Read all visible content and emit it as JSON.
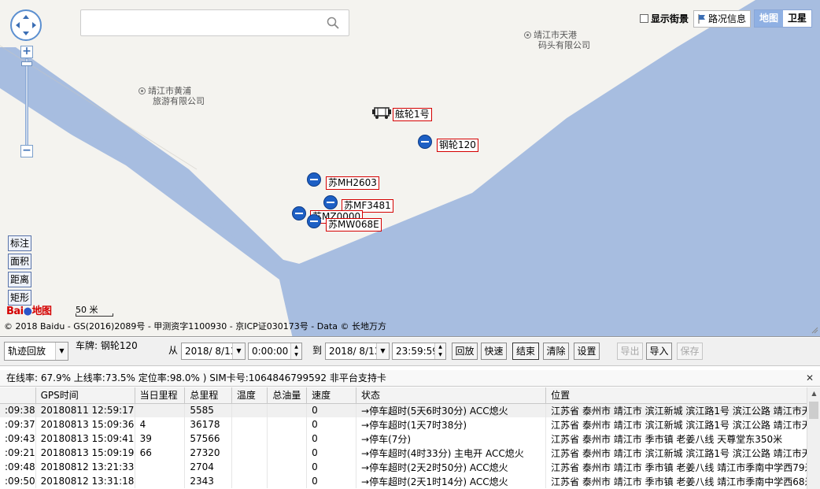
{
  "map": {
    "search_placeholder": "",
    "street_view_label": "显示街景",
    "traffic_label": "路况信息",
    "map_type_map": "地图",
    "map_type_satellite": "卫星",
    "zoom_in": "+",
    "zoom_out": "−",
    "tools": [
      "标注",
      "面积",
      "距离",
      "矩形"
    ],
    "scale_label": "50 米",
    "copyright": "© 2018 Baidu - GS(2016)2089号 - 甲测资字1100930 - 京ICP证030173号 - Data © 长地万方",
    "logo_text": "Bai地图",
    "pois": [
      {
        "line1": "靖江市黄浦",
        "line2": "旅游有限公司"
      },
      {
        "line1": "靖江市天港",
        "line2": "码头有限公司"
      }
    ],
    "vehicles": [
      "舷轮1号",
      "钢轮120",
      "苏MH2603",
      "苏MF3481",
      "苏MZ0000",
      "苏MW068E"
    ]
  },
  "toolbar": {
    "mode_select": "轨迹回放",
    "plate_label": "车牌: 钢轮120",
    "from_label": "从",
    "to_label": "到",
    "from_date": "2018/ 8/13",
    "from_time": "0:00:00",
    "to_date": "2018/ 8/13",
    "to_time": "23:59:59",
    "btn_replay": "回放",
    "btn_fast": "快速",
    "btn_end": "结束",
    "btn_clear": "清除",
    "btn_settings": "设置",
    "btn_export": "导出",
    "btn_import": "导入",
    "btn_save": "保存"
  },
  "status": {
    "text": "在线率: 67.9% 上线率:73.5% 定位率:98.0% ) SIM卡号:1064846799592 非平台支持卡",
    "close": "✕"
  },
  "table": {
    "headers": [
      "",
      "GPS时间",
      "当日里程",
      "总里程",
      "温度",
      "总油量",
      "速度",
      "状态",
      "位置"
    ],
    "rows": [
      [
        ":09:38",
        "20180811 12:59:17",
        "",
        "5585",
        "",
        "",
        "0",
        "→停车超时(5天6时30分) ACC熄火",
        "江苏省 泰州市 靖江市 滨江新城 滨江路1号 滨江公路 靖江市天"
      ],
      [
        ":09:37",
        "20180813 15:09:36",
        "4",
        "36178",
        "",
        "",
        "0",
        "→停车超时(1天7时38分)",
        "江苏省 泰州市 靖江市 滨江新城 滨江路1号 滨江公路 靖江市天"
      ],
      [
        ":09:43",
        "20180813 15:09:41",
        "39",
        "57566",
        "",
        "",
        "0",
        "→停车(7分)",
        "江苏省 泰州市 靖江市 季市镇 老姜八线 天尊堂东350米"
      ],
      [
        ":09:21",
        "20180813 15:09:19",
        "66",
        "27320",
        "",
        "",
        "0",
        "→停车超时(4时33分)  主电开 ACC熄火",
        "江苏省 泰州市 靖江市 滨江新城 滨江路1号 滨江公路 靖江市天"
      ],
      [
        ":09:48",
        "20180812 13:21:33",
        "",
        "2704",
        "",
        "",
        "0",
        "→停车超时(2天2时50分) ACC熄火",
        "江苏省 泰州市 靖江市 季市镇 老姜八线 靖江市季南中学西79米"
      ],
      [
        ":09:50",
        "20180812 13:31:18",
        "",
        "2343",
        "",
        "",
        "0",
        "→停车超时(2天1时14分) ACC熄火",
        "江苏省 泰州市 靖江市 季市镇 老姜八线 靖江市季南中学西68米"
      ]
    ]
  }
}
